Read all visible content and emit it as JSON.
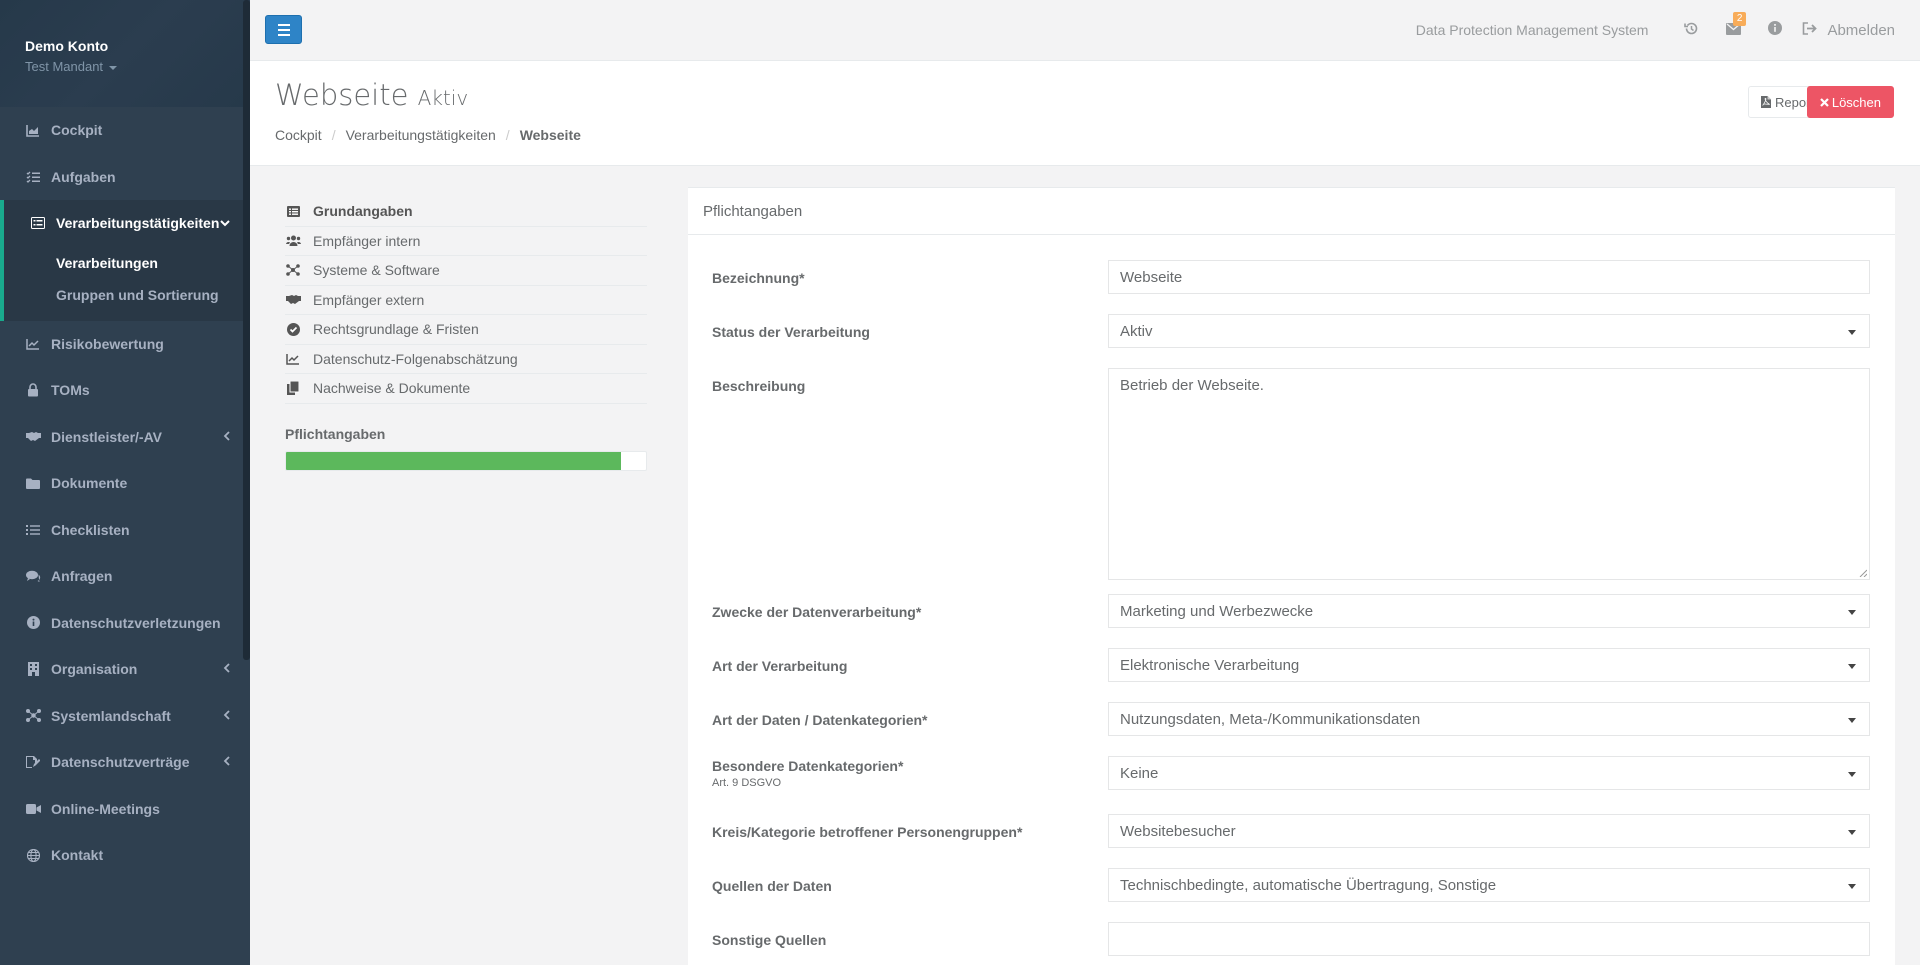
{
  "sidebar": {
    "profile_name": "Demo Konto",
    "tenant": "Test Mandant",
    "items": [
      {
        "label": "Cockpit",
        "icon": "chart-area-icon"
      },
      {
        "label": "Aufgaben",
        "icon": "tasks-icon"
      },
      {
        "label": "Verarbeitungstätigkeiten",
        "icon": "list-alt-icon"
      },
      {
        "label": "Risikobewertung",
        "icon": "line-chart-icon"
      },
      {
        "label": "TOMs",
        "icon": "lock-icon"
      },
      {
        "label": "Dienstleister/-AV",
        "icon": "handshake-icon"
      },
      {
        "label": "Dokumente",
        "icon": "folder-icon"
      },
      {
        "label": "Checklisten",
        "icon": "list-icon"
      },
      {
        "label": "Anfragen",
        "icon": "comments-icon"
      },
      {
        "label": "Datenschutzverletzungen",
        "icon": "info-circle-icon"
      },
      {
        "label": "Organisation",
        "icon": "building-icon"
      },
      {
        "label": "Systemlandschaft",
        "icon": "network-icon"
      },
      {
        "label": "Datenschutzverträge",
        "icon": "signature-icon"
      },
      {
        "label": "Online-Meetings",
        "icon": "video-icon"
      },
      {
        "label": "Kontakt",
        "icon": "globe-icon"
      }
    ],
    "subitems": [
      "Verarbeitungen",
      "Gruppen und Sortierung"
    ]
  },
  "topbar": {
    "system_title": "Data Protection Management System",
    "message_count": "2",
    "logout_label": "Abmelden"
  },
  "heading": {
    "title": "Webseite",
    "status": "Aktiv",
    "breadcrumb": [
      "Cockpit",
      "Verarbeitungstätigkeiten",
      "Webseite"
    ],
    "report_label": "Report",
    "delete_label": "Löschen"
  },
  "submenu": {
    "items": [
      {
        "label": "Grundangaben",
        "icon": "list-alt-icon"
      },
      {
        "label": "Empfänger intern",
        "icon": "users-icon"
      },
      {
        "label": "Systeme & Software",
        "icon": "network-icon"
      },
      {
        "label": "Empfänger extern",
        "icon": "handshake-icon"
      },
      {
        "label": "Rechtsgrundlage & Fristen",
        "icon": "check-circle-icon"
      },
      {
        "label": "Datenschutz-Folgenabschätzung",
        "icon": "line-chart-icon"
      },
      {
        "label": "Nachweise & Dokumente",
        "icon": "copy-icon"
      }
    ],
    "progress_label": "Pflichtangaben",
    "progress_percent": 93
  },
  "form": {
    "panel_title": "Pflichtangaben",
    "fields": [
      {
        "label": "Bezeichnung*",
        "value": "Webseite",
        "type": "text"
      },
      {
        "label": "Status der Verarbeitung",
        "value": "Aktiv",
        "type": "select"
      },
      {
        "label": "Beschreibung",
        "value": "Betrieb der Webseite.",
        "type": "textarea"
      },
      {
        "label": "Zwecke der Datenverarbeitung*",
        "value": "Marketing und Werbezwecke",
        "type": "select"
      },
      {
        "label": "Art der Verarbeitung",
        "value": "Elektronische Verarbeitung",
        "type": "select"
      },
      {
        "label": "Art der Daten / Datenkategorien*",
        "value": "Nutzungsdaten, Meta-/Kommunikationsdaten",
        "type": "select"
      },
      {
        "label": "Besondere Datenkategorien*",
        "hint": "Art. 9 DSGVO",
        "value": "Keine",
        "type": "select"
      },
      {
        "label": "Kreis/Kategorie betroffener Personengruppen*",
        "value": "Websitebesucher",
        "type": "select"
      },
      {
        "label": "Quellen der Daten",
        "value": "Technischbedingte, automatische Übertragung, Sonstige",
        "type": "select"
      },
      {
        "label": "Sonstige Quellen",
        "value": "",
        "type": "text"
      }
    ]
  },
  "colors": {
    "sidebar_bg": "#2f4050",
    "accent_green": "#5cb85c",
    "primary_blue": "#2e84c7",
    "danger_red": "#ed5565",
    "badge_orange": "#f8ac59"
  }
}
